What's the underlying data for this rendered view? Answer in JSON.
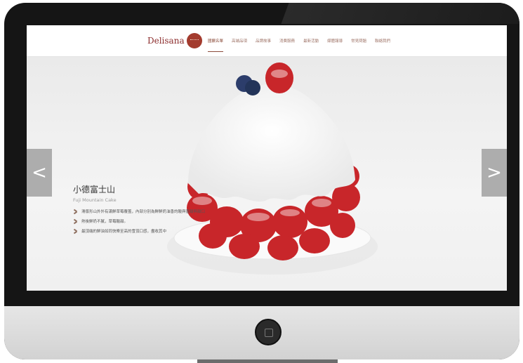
{
  "logo": {
    "text": "Delisana"
  },
  "nav": {
    "items": [
      "國饌名單",
      "高端品項",
      "品牌故事",
      "消費服務",
      "最新活動",
      "媒體報導",
      "常見問題",
      "聯絡我們"
    ]
  },
  "hero": {
    "title": "小德富士山",
    "subtitle": "Fuji Mountain Cake",
    "features": [
      "滑版形山外外有滿鮮草莓覆蓋，內部分別為鮮鮮奶油香的酸與香甜與甜口",
      "熱後鮮奶不膩，草莓酸甜。",
      "最頂端的鮮油如同快樂至高的雪頂口感，盡收其中"
    ],
    "prev_icon": "chevron-left-icon",
    "next_icon": "chevron-right-icon"
  }
}
